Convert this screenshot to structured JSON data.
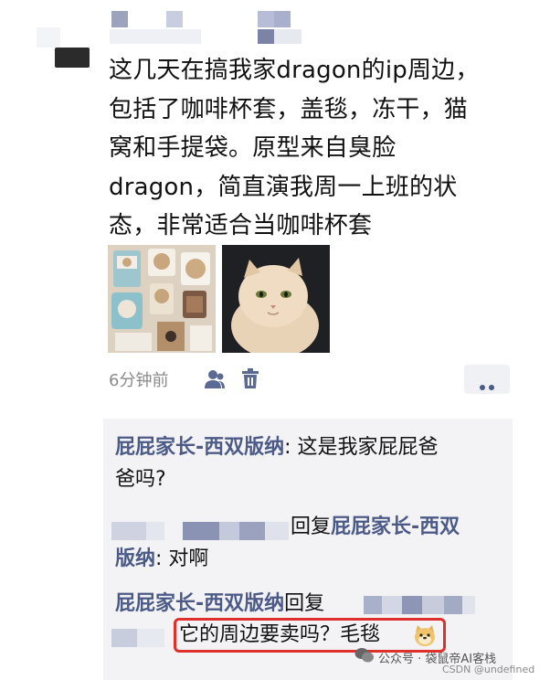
{
  "post": {
    "lines": [
      "这几天在搞我家dragon的ip周边，",
      "包括了咖啡杯套，盖毯，冻干，猫",
      "窝和手提袋。原型来自臭脸",
      "dragon，简直演我周一上班的状",
      "态，非常适合当咖啡杯套"
    ]
  },
  "meta": {
    "time": "6分钟前",
    "icons": [
      "person-icon",
      "trash-icon",
      "more-dots-icon"
    ]
  },
  "comments": {
    "c1_user": "屁屁家长-西双版纳",
    "c1_sep": ":",
    "c1_text1": " 这是我家屁屁爸",
    "c1_text2": "爸吗?",
    "c2_reply": "回复",
    "c2_target1": "屁屁家长-西双",
    "c2_target2": "版纳",
    "c2_text": ": 对啊",
    "c3_user": "屁屁家长-西双版纳",
    "c3_reply": "回复",
    "c3_text": "它的周边要卖吗？毛毯"
  },
  "watermark": {
    "line1": "公众号 · 袋鼠帝AI客栈",
    "line2": "CSDN @undefined"
  },
  "colors": {
    "username": "#4b5a86",
    "highlight": "#e0302b",
    "comment_bg": "#f3f3f5"
  }
}
